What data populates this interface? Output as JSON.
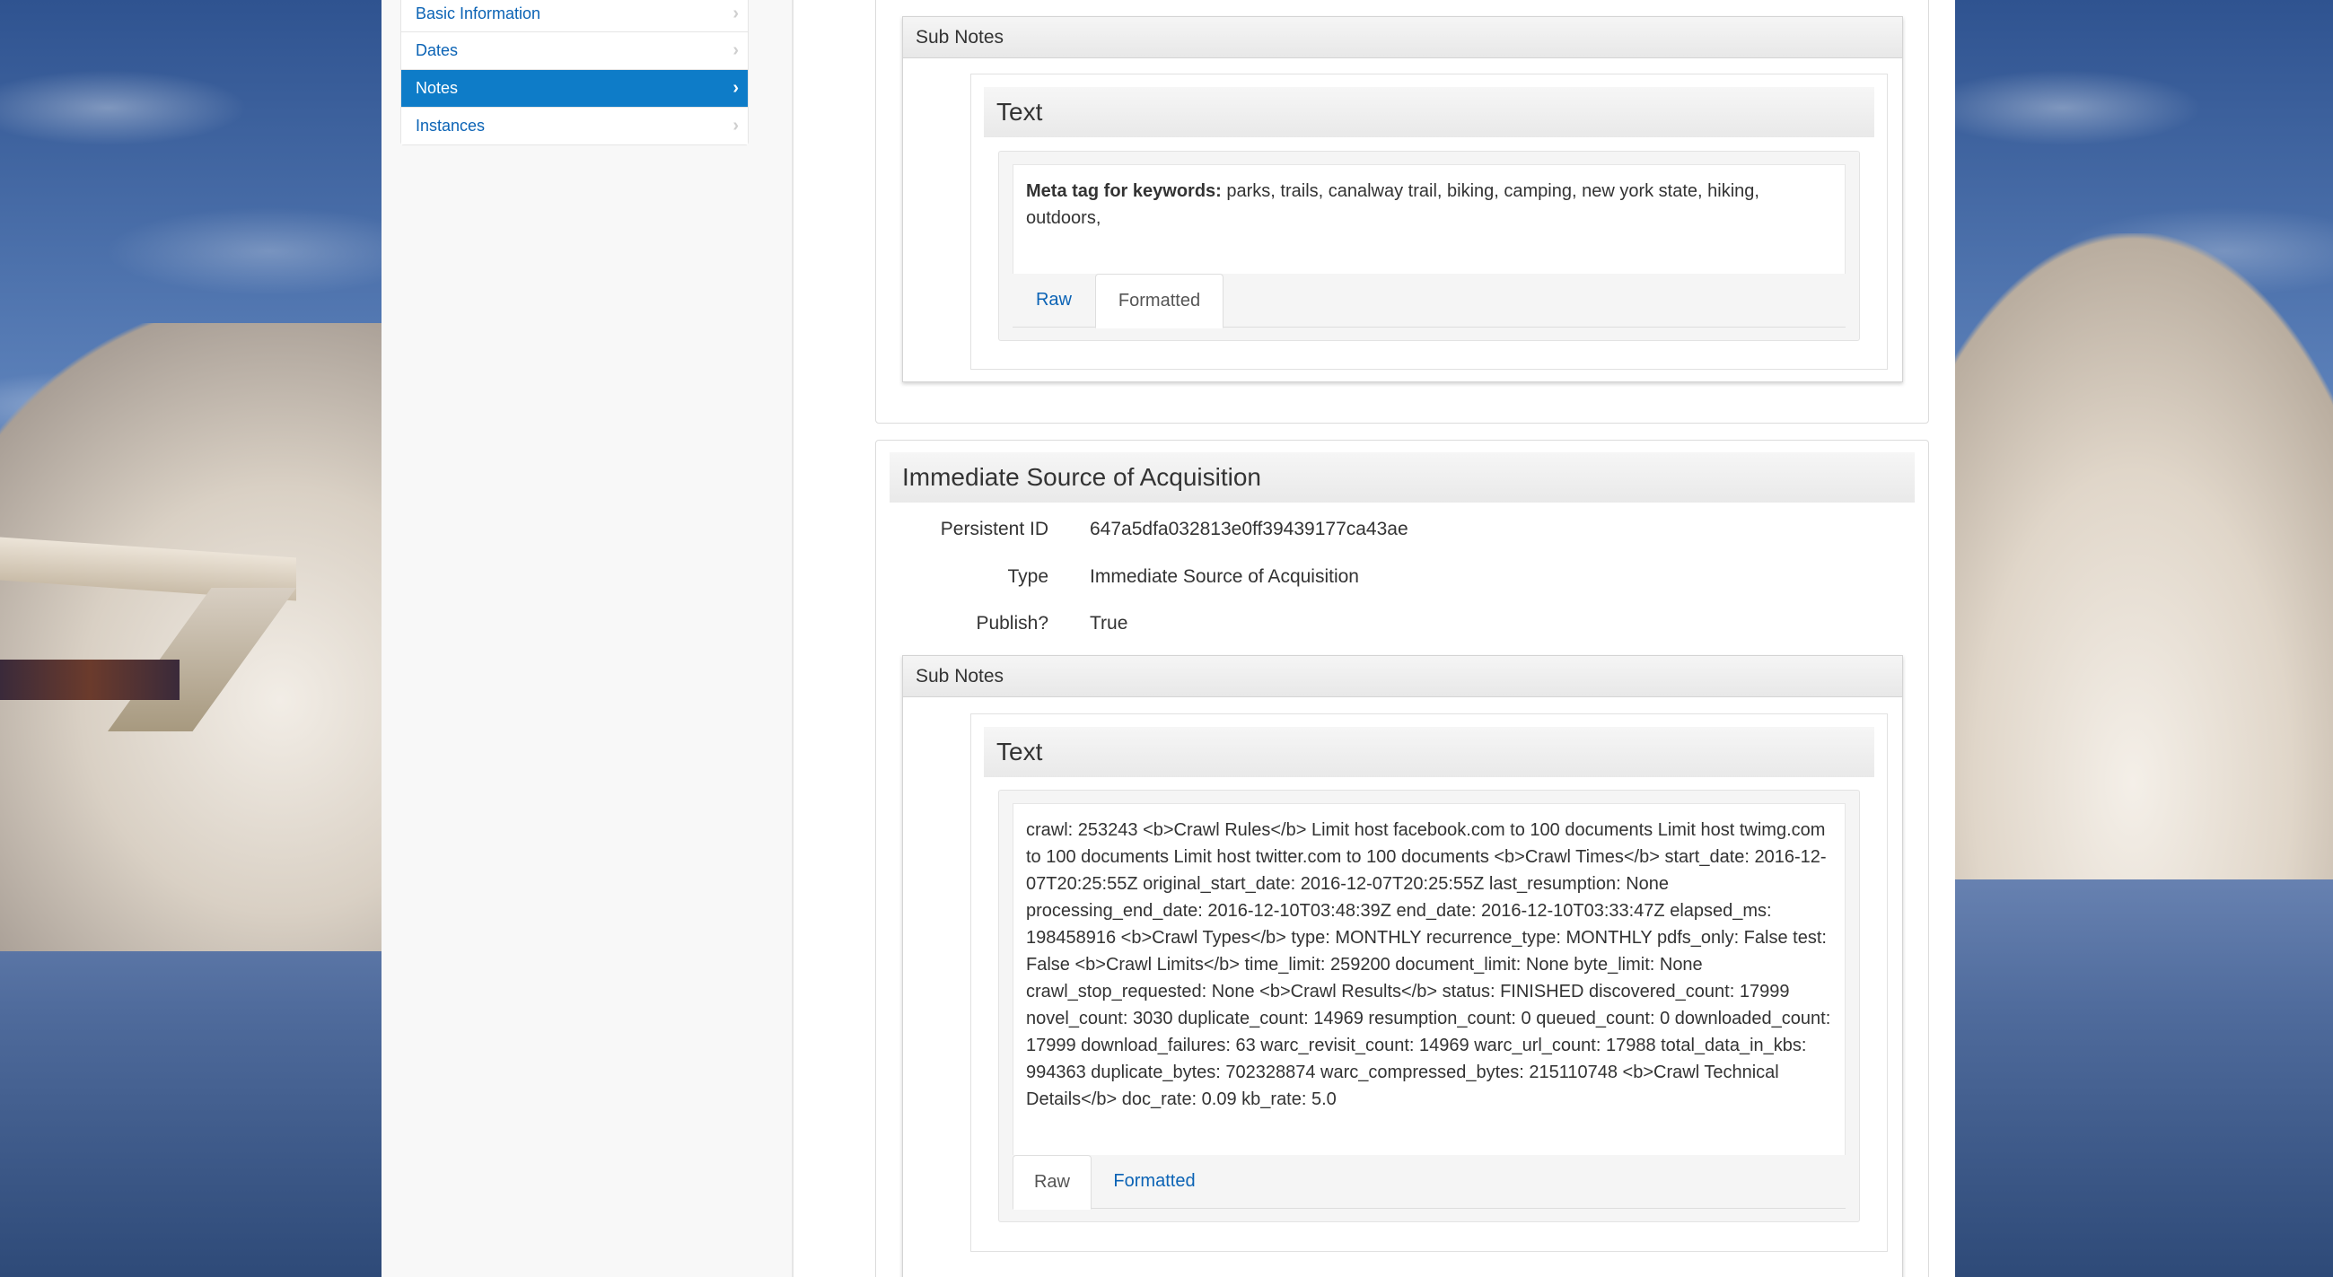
{
  "sidebar": {
    "items": [
      {
        "label": "Basic Information",
        "active": false
      },
      {
        "label": "Dates",
        "active": false
      },
      {
        "label": "Notes",
        "active": true
      },
      {
        "label": "Instances",
        "active": false
      }
    ]
  },
  "note1": {
    "subnotes_title": "Sub Notes",
    "text_card_title": "Text",
    "text_label": "Meta tag for keywords:",
    "text_value": " parks, trails, canalway trail, biking, camping, new york state, hiking, outdoors,",
    "tabs": [
      {
        "label": "Raw",
        "active": false
      },
      {
        "label": "Formatted",
        "active": true
      }
    ]
  },
  "note2": {
    "section_title": "Immediate Source of Acquisition",
    "fields": [
      {
        "label": "Persistent ID",
        "value": "647a5dfa032813e0ff39439177ca43ae"
      },
      {
        "label": "Type",
        "value": "Immediate Source of Acquisition"
      },
      {
        "label": "Publish?",
        "value": "True"
      }
    ],
    "subnotes_title": "Sub Notes",
    "text_card_title": "Text",
    "text_value": "crawl: 253243 <b>Crawl Rules</b> Limit host facebook.com to 100 documents Limit host twimg.com to 100 documents Limit host twitter.com to 100 documents <b>Crawl Times</b> start_date: 2016-12-07T20:25:55Z original_start_date: 2016-12-07T20:25:55Z last_resumption: None processing_end_date: 2016-12-10T03:48:39Z end_date: 2016-12-10T03:33:47Z elapsed_ms: 198458916 <b>Crawl Types</b> type: MONTHLY recurrence_type: MONTHLY pdfs_only: False test: False <b>Crawl Limits</b> time_limit: 259200 document_limit: None byte_limit: None crawl_stop_requested: None <b>Crawl Results</b> status: FINISHED discovered_count: 17999 novel_count: 3030 duplicate_count: 14969 resumption_count: 0 queued_count: 0 downloaded_count: 17999 download_failures: 63 warc_revisit_count: 14969 warc_url_count: 17988 total_data_in_kbs: 994363 duplicate_bytes: 702328874 warc_compressed_bytes: 215110748 <b>Crawl Technical Details</b> doc_rate: 0.09 kb_rate: 5.0",
    "tabs": [
      {
        "label": "Raw",
        "active": true
      },
      {
        "label": "Formatted",
        "active": false
      }
    ]
  }
}
